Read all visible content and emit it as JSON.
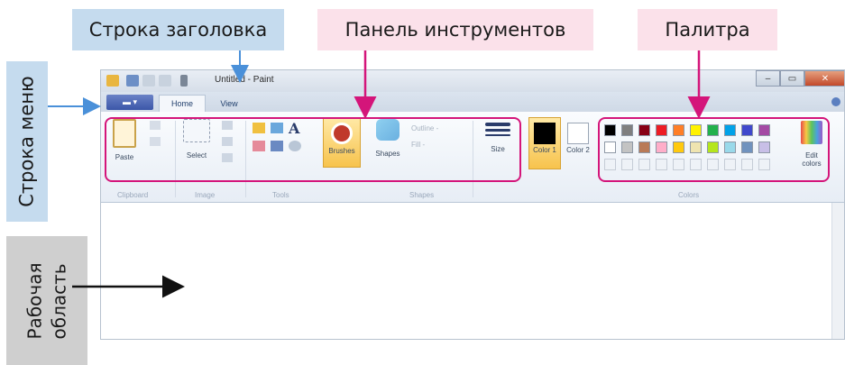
{
  "callouts": {
    "title_bar": "Строка заголовка",
    "toolbar": "Панель инструментов",
    "palette": "Палитра",
    "menu_bar": "Строка меню",
    "work_area_line1": "Рабочая",
    "work_area_line2": "область"
  },
  "window": {
    "title": "Untitled - Paint",
    "app_menu": "▬ ▾",
    "tabs": [
      "Home",
      "View"
    ],
    "buttons": {
      "minimize": "–",
      "maximize": "▭",
      "close": "✕"
    }
  },
  "ribbon": {
    "groups": [
      "Clipboard",
      "Image",
      "Tools",
      "Shapes",
      "Colors"
    ],
    "tools": {
      "paste": "Paste",
      "select": "Select",
      "brushes": "Brushes",
      "shapes": "Shapes",
      "outline": "Outline -",
      "fill": "Fill -",
      "size": "Size",
      "color1": "Color 1",
      "color2": "Color 2",
      "edit_colors": "Edit colors"
    }
  },
  "palette_colors": {
    "row1": [
      "#000000",
      "#7f7f7f",
      "#880015",
      "#ed1c24",
      "#ff7f27",
      "#fff200",
      "#22b14c",
      "#00a2e8",
      "#3f48cc",
      "#a349a4"
    ],
    "row2": [
      "#ffffff",
      "#c3c3c3",
      "#b97a57",
      "#ffaec9",
      "#ffc90e",
      "#efe4b0",
      "#b5e61d",
      "#99d9ea",
      "#7092be",
      "#c8bfe7"
    ]
  },
  "accent_color": "#d4157a"
}
